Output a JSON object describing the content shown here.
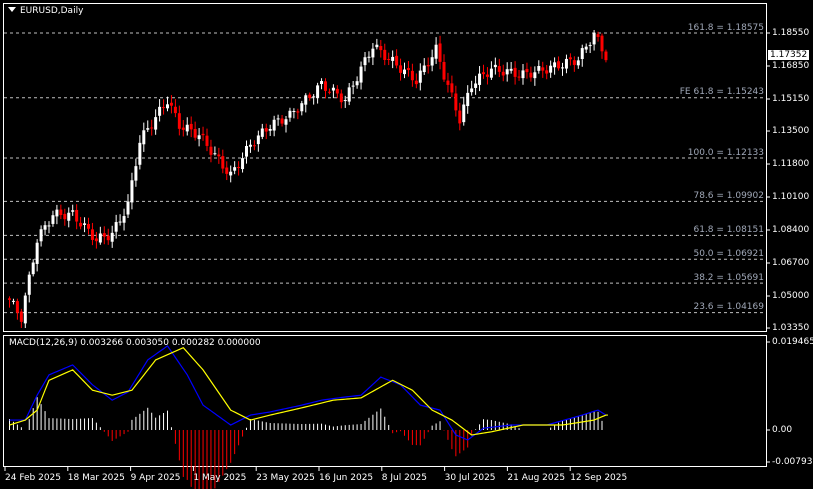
{
  "header": {
    "symbol_title": "EURUSD,Daily"
  },
  "current_price": "1.17352",
  "colors": {
    "bull": "#ffffff",
    "bear": "#ff0000",
    "macd": "#0000ff",
    "signal": "#ffff00",
    "grid": "#c0c0c0",
    "fib_text": "#a0a8b8"
  },
  "price_axis": [
    "1.18550",
    "1.16850",
    "1.15150",
    "1.13500",
    "1.11800",
    "1.10100",
    "1.08400",
    "1.06700",
    "1.05000",
    "1.03350"
  ],
  "fib_levels": [
    {
      "label": "161.8 = 1.18575",
      "price": 1.18575
    },
    {
      "label": "FE 61.8 = 1.15243",
      "price": 1.15243
    },
    {
      "label": "100.0 = 1.12133",
      "price": 1.12133
    },
    {
      "label": "78.6 = 1.09902",
      "price": 1.09902
    },
    {
      "label": "61.8 = 1.08151",
      "price": 1.08151
    },
    {
      "label": "50.0 = 1.06921",
      "price": 1.06921
    },
    {
      "label": "38.2 = 1.05691",
      "price": 1.05691
    },
    {
      "label": "23.6 = 1.04169",
      "price": 1.04169
    }
  ],
  "macd_panel": {
    "label": "MACD(12,26,9) 0.003266 0.003050 0.000282 0.000000",
    "axis": [
      "0.019465",
      "0.00",
      "-0.007939"
    ]
  },
  "date_axis": [
    "24 Feb 2025",
    "18 Mar 2025",
    "9 Apr 2025",
    "1 May 2025",
    "23 May 2025",
    "16 Jun 2025",
    "8 Jul 2025",
    "30 Jul 2025",
    "21 Aug 2025",
    "12 Sep 2025"
  ],
  "chart_data": {
    "type": "candlestick",
    "price_range": [
      1.0335,
      1.1855
    ],
    "price_path": [
      [
        0,
        1.048
      ],
      [
        3,
        1.039
      ],
      [
        7,
        1.079
      ],
      [
        11,
        1.092
      ],
      [
        16,
        1.092
      ],
      [
        22,
        1.079
      ],
      [
        26,
        1.082
      ],
      [
        30,
        1.097
      ],
      [
        33,
        1.13
      ],
      [
        40,
        1.151
      ],
      [
        43,
        1.138
      ],
      [
        48,
        1.133
      ],
      [
        56,
        1.112
      ],
      [
        61,
        1.128
      ],
      [
        66,
        1.138
      ],
      [
        71,
        1.143
      ],
      [
        79,
        1.159
      ],
      [
        85,
        1.151
      ],
      [
        92,
        1.179
      ],
      [
        98,
        1.169
      ],
      [
        103,
        1.161
      ],
      [
        108,
        1.177
      ],
      [
        110,
        1.164
      ],
      [
        114,
        1.141
      ],
      [
        117,
        1.159
      ],
      [
        122,
        1.167
      ],
      [
        130,
        1.164
      ],
      [
        136,
        1.167
      ],
      [
        144,
        1.172
      ],
      [
        148,
        1.185
      ],
      [
        151,
        1.1735
      ]
    ],
    "macd": [
      [
        0,
        0.0022
      ],
      [
        4,
        0.0022
      ],
      [
        7,
        0.0077
      ],
      [
        10,
        0.0122
      ],
      [
        16,
        0.0144
      ],
      [
        21,
        0.01
      ],
      [
        26,
        0.0066
      ],
      [
        30,
        0.0084
      ],
      [
        35,
        0.0155
      ],
      [
        40,
        0.0186
      ],
      [
        45,
        0.0122
      ],
      [
        49,
        0.0055
      ],
      [
        56,
        0.0011
      ],
      [
        61,
        0.0033
      ],
      [
        66,
        0.004
      ],
      [
        74,
        0.0055
      ],
      [
        79,
        0.0066
      ],
      [
        85,
        0.0073
      ],
      [
        89,
        0.0077
      ],
      [
        94,
        0.0117
      ],
      [
        99,
        0.01
      ],
      [
        104,
        0.0055
      ],
      [
        109,
        0.0044
      ],
      [
        113,
        -0.0011
      ],
      [
        116,
        -0.0022
      ],
      [
        120,
        0.0004
      ],
      [
        127,
        0.0011
      ],
      [
        136,
        0.0011
      ],
      [
        145,
        0.0033
      ],
      [
        149,
        0.0044
      ],
      [
        151,
        0.0033
      ]
    ],
    "signal": [
      [
        0,
        0.0011
      ],
      [
        4,
        0.0022
      ],
      [
        7,
        0.0044
      ],
      [
        10,
        0.011
      ],
      [
        16,
        0.0133
      ],
      [
        21,
        0.0088
      ],
      [
        26,
        0.0077
      ],
      [
        31,
        0.0088
      ],
      [
        37,
        0.0155
      ],
      [
        44,
        0.0182
      ],
      [
        49,
        0.0133
      ],
      [
        56,
        0.0044
      ],
      [
        61,
        0.0022
      ],
      [
        66,
        0.0033
      ],
      [
        74,
        0.0049
      ],
      [
        82,
        0.0066
      ],
      [
        89,
        0.0071
      ],
      [
        97,
        0.011
      ],
      [
        102,
        0.0088
      ],
      [
        107,
        0.0044
      ],
      [
        112,
        0.0022
      ],
      [
        117,
        -0.0011
      ],
      [
        122,
        -0.0004
      ],
      [
        130,
        0.0011
      ],
      [
        140,
        0.0011
      ],
      [
        148,
        0.0022
      ],
      [
        151,
        0.0033
      ]
    ]
  }
}
